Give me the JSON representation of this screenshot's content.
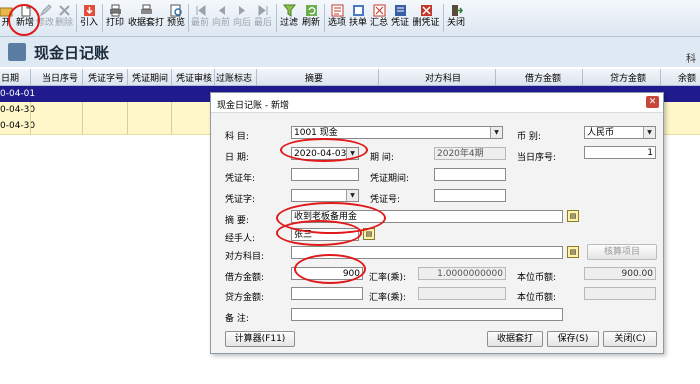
{
  "toolbar": {
    "buttons": [
      {
        "label": "开",
        "icon": "folder-icon",
        "enabled": true
      },
      {
        "label": "新增",
        "icon": "new-document-icon",
        "enabled": true
      },
      {
        "label": "修改",
        "icon": "edit-icon",
        "enabled": false
      },
      {
        "label": "删除",
        "icon": "delete-icon",
        "enabled": false
      },
      {
        "label": "引入",
        "icon": "import-icon",
        "enabled": true
      },
      {
        "label": "打印",
        "icon": "printer-icon",
        "enabled": true
      },
      {
        "label": "收据套打",
        "icon": "receipt-print-icon",
        "enabled": true
      },
      {
        "label": "预览",
        "icon": "preview-icon",
        "enabled": true
      },
      {
        "label": "最前",
        "icon": "first-icon",
        "enabled": false
      },
      {
        "label": "向前",
        "icon": "prev-icon",
        "enabled": false
      },
      {
        "label": "向后",
        "icon": "next-icon",
        "enabled": false
      },
      {
        "label": "最后",
        "icon": "last-icon",
        "enabled": false
      },
      {
        "label": "过滤",
        "icon": "filter-icon",
        "enabled": true
      },
      {
        "label": "刷新",
        "icon": "refresh-icon",
        "enabled": true
      },
      {
        "label": "选项",
        "icon": "options-icon",
        "enabled": true
      },
      {
        "label": "扶单",
        "icon": "voucher-icon",
        "enabled": true
      },
      {
        "label": "汇总",
        "icon": "summary-icon",
        "enabled": true
      },
      {
        "label": "凭证",
        "icon": "certificate-icon",
        "enabled": true
      },
      {
        "label": "删凭证",
        "icon": "delete-certificate-icon",
        "enabled": true
      },
      {
        "label": "关闭",
        "icon": "exit-icon",
        "enabled": true
      }
    ]
  },
  "page": {
    "title": "现金日记账",
    "right_text": "科"
  },
  "grid": {
    "columns": [
      "日期",
      "当日序号",
      "凭证字号",
      "凭证期间",
      "凭证审核",
      "过账标志",
      "摘要",
      "对方科目",
      "借方金额",
      "贷方金额",
      "余额"
    ],
    "rows": [
      {
        "date": "0-04-01",
        "selected": true
      },
      {
        "date": "0-04-30",
        "selected": false
      },
      {
        "date": "0-04-30",
        "selected": false
      }
    ]
  },
  "dialog": {
    "title": "现金日记账 - 新增",
    "close_glyph": "✕",
    "labels": {
      "subject": "科  目:",
      "currency": "币  别:",
      "date": "日  期:",
      "period": "期  间:",
      "daily_seq": "当日序号:",
      "voucher_year": "凭证年:",
      "voucher_period": "凭证期间:",
      "voucher_word": "凭证字:",
      "voucher_no": "凭证号:",
      "summary": "摘  要:",
      "handler": "经手人:",
      "counter_account": "对方科目:",
      "debit": "借方金额:",
      "rate1": "汇率(乘):",
      "base_currency1": "本位币额:",
      "credit": "贷方金额:",
      "rate2": "汇率(乘):",
      "base_currency2": "本位币额:",
      "remark": "备  注:"
    },
    "values": {
      "subject": "1001 现金",
      "currency": "人民币",
      "date": "2020-04-03",
      "period": "2020年4期",
      "daily_seq": "1",
      "voucher_year": "",
      "voucher_period": "",
      "voucher_word": "",
      "voucher_no": "",
      "summary": "收到老板备用金",
      "handler": "张三",
      "counter_account": "",
      "debit": "900",
      "rate1": "1.0000000000",
      "base_currency1": "900.00",
      "credit": "",
      "rate2": "",
      "base_currency2": "",
      "remark": ""
    },
    "buttons": {
      "check_items": "核算项目",
      "calculator": "计算器(F11)",
      "receipt_print": "收据套打",
      "save": "保存(S)",
      "close": "关闭(C)"
    }
  },
  "colors": {
    "annotation": "#e01a1a",
    "selected_row": "#1f1a8e",
    "highlight_row": "#fff7c9"
  }
}
